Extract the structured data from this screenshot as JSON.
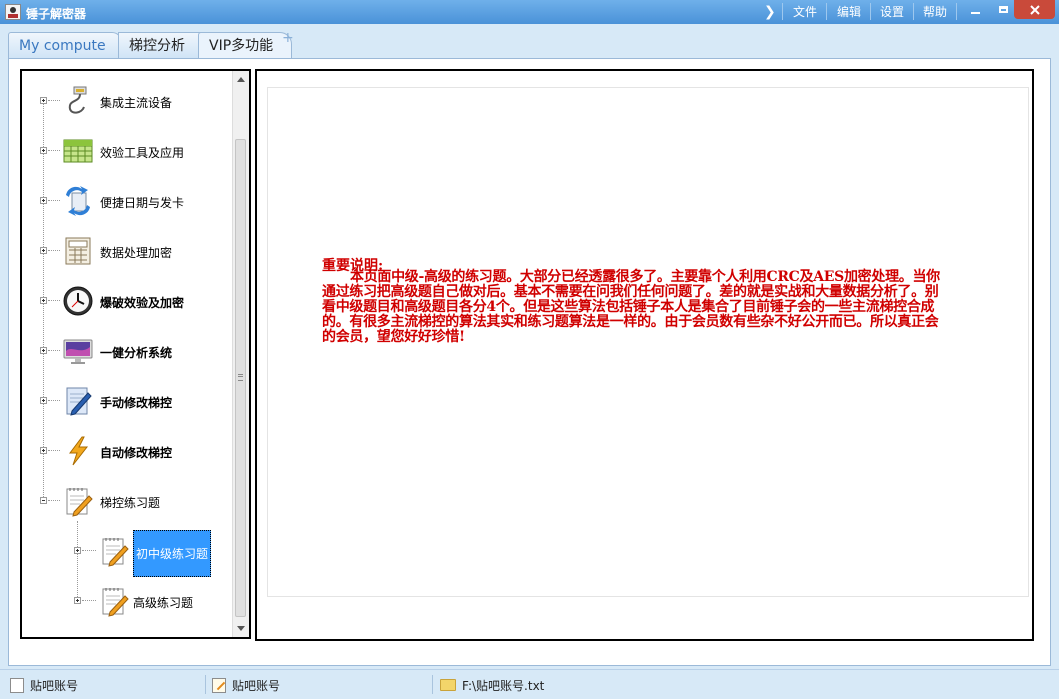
{
  "window": {
    "title": "锤子解密器"
  },
  "menu": {
    "arrow": "❯",
    "items": [
      "文件",
      "编辑",
      "设置",
      "帮助"
    ]
  },
  "tabs": [
    {
      "label": "My compute",
      "active": false
    },
    {
      "label": "梯控分析",
      "active": false
    },
    {
      "label": "VIP多功能",
      "active": true
    }
  ],
  "tab_add": "+",
  "tree": {
    "items": [
      {
        "label": "集成主流设备",
        "icon": "usb-cable-icon",
        "bold": false
      },
      {
        "label": "效验工具及应用",
        "icon": "spreadsheet-icon",
        "bold": false
      },
      {
        "label": "便捷日期与发卡",
        "icon": "sync-arrows-icon",
        "bold": false
      },
      {
        "label": "数据处理加密",
        "icon": "calculator-icon",
        "bold": false
      },
      {
        "label": "爆破效验及加密",
        "icon": "clock-icon",
        "bold": true
      },
      {
        "label": "一健分析系统",
        "icon": "monitor-icon",
        "bold": true
      },
      {
        "label": "手动修改梯控",
        "icon": "pencil-note-icon",
        "bold": true
      },
      {
        "label": "自动修改梯控",
        "icon": "lightning-icon",
        "bold": true
      },
      {
        "label": "梯控练习题",
        "icon": "notepad-icon",
        "bold": false
      }
    ],
    "children": [
      {
        "label": "初中级练习题",
        "icon": "notepad-icon",
        "selected": true
      },
      {
        "label": "高级练习题",
        "icon": "notepad-icon",
        "selected": false
      }
    ]
  },
  "notice": {
    "title": "重要说明:",
    "body": "本页面中级-高级的练习题。大部分已经透露很多了。主要靠个人利用CRC及AES加密处理。当你通过练习把高级题自己做对后。基本不需要在问我们任何问题了。差的就是实战和大量数据分析了。别看中级题目和高级题目各分4个。但是这些算法包括锤子本人是集合了目前锤子会的一些主流梯控合成的。有很多主流梯控的算法其实和练习题算法是一样的。由于会员数有些杂不好公开而已。所以真正会的会员，望您好好珍惜!"
  },
  "status": [
    {
      "label": "贴吧账号",
      "icon": "document-icon"
    },
    {
      "label": "贴吧账号",
      "icon": "edit-icon"
    },
    {
      "label": "F:\\贴吧账号.txt",
      "icon": "folder-icon"
    }
  ],
  "colors": {
    "title_bar": "#4a92d8",
    "notice_text": "#d00000",
    "selection": "#3399ff"
  }
}
